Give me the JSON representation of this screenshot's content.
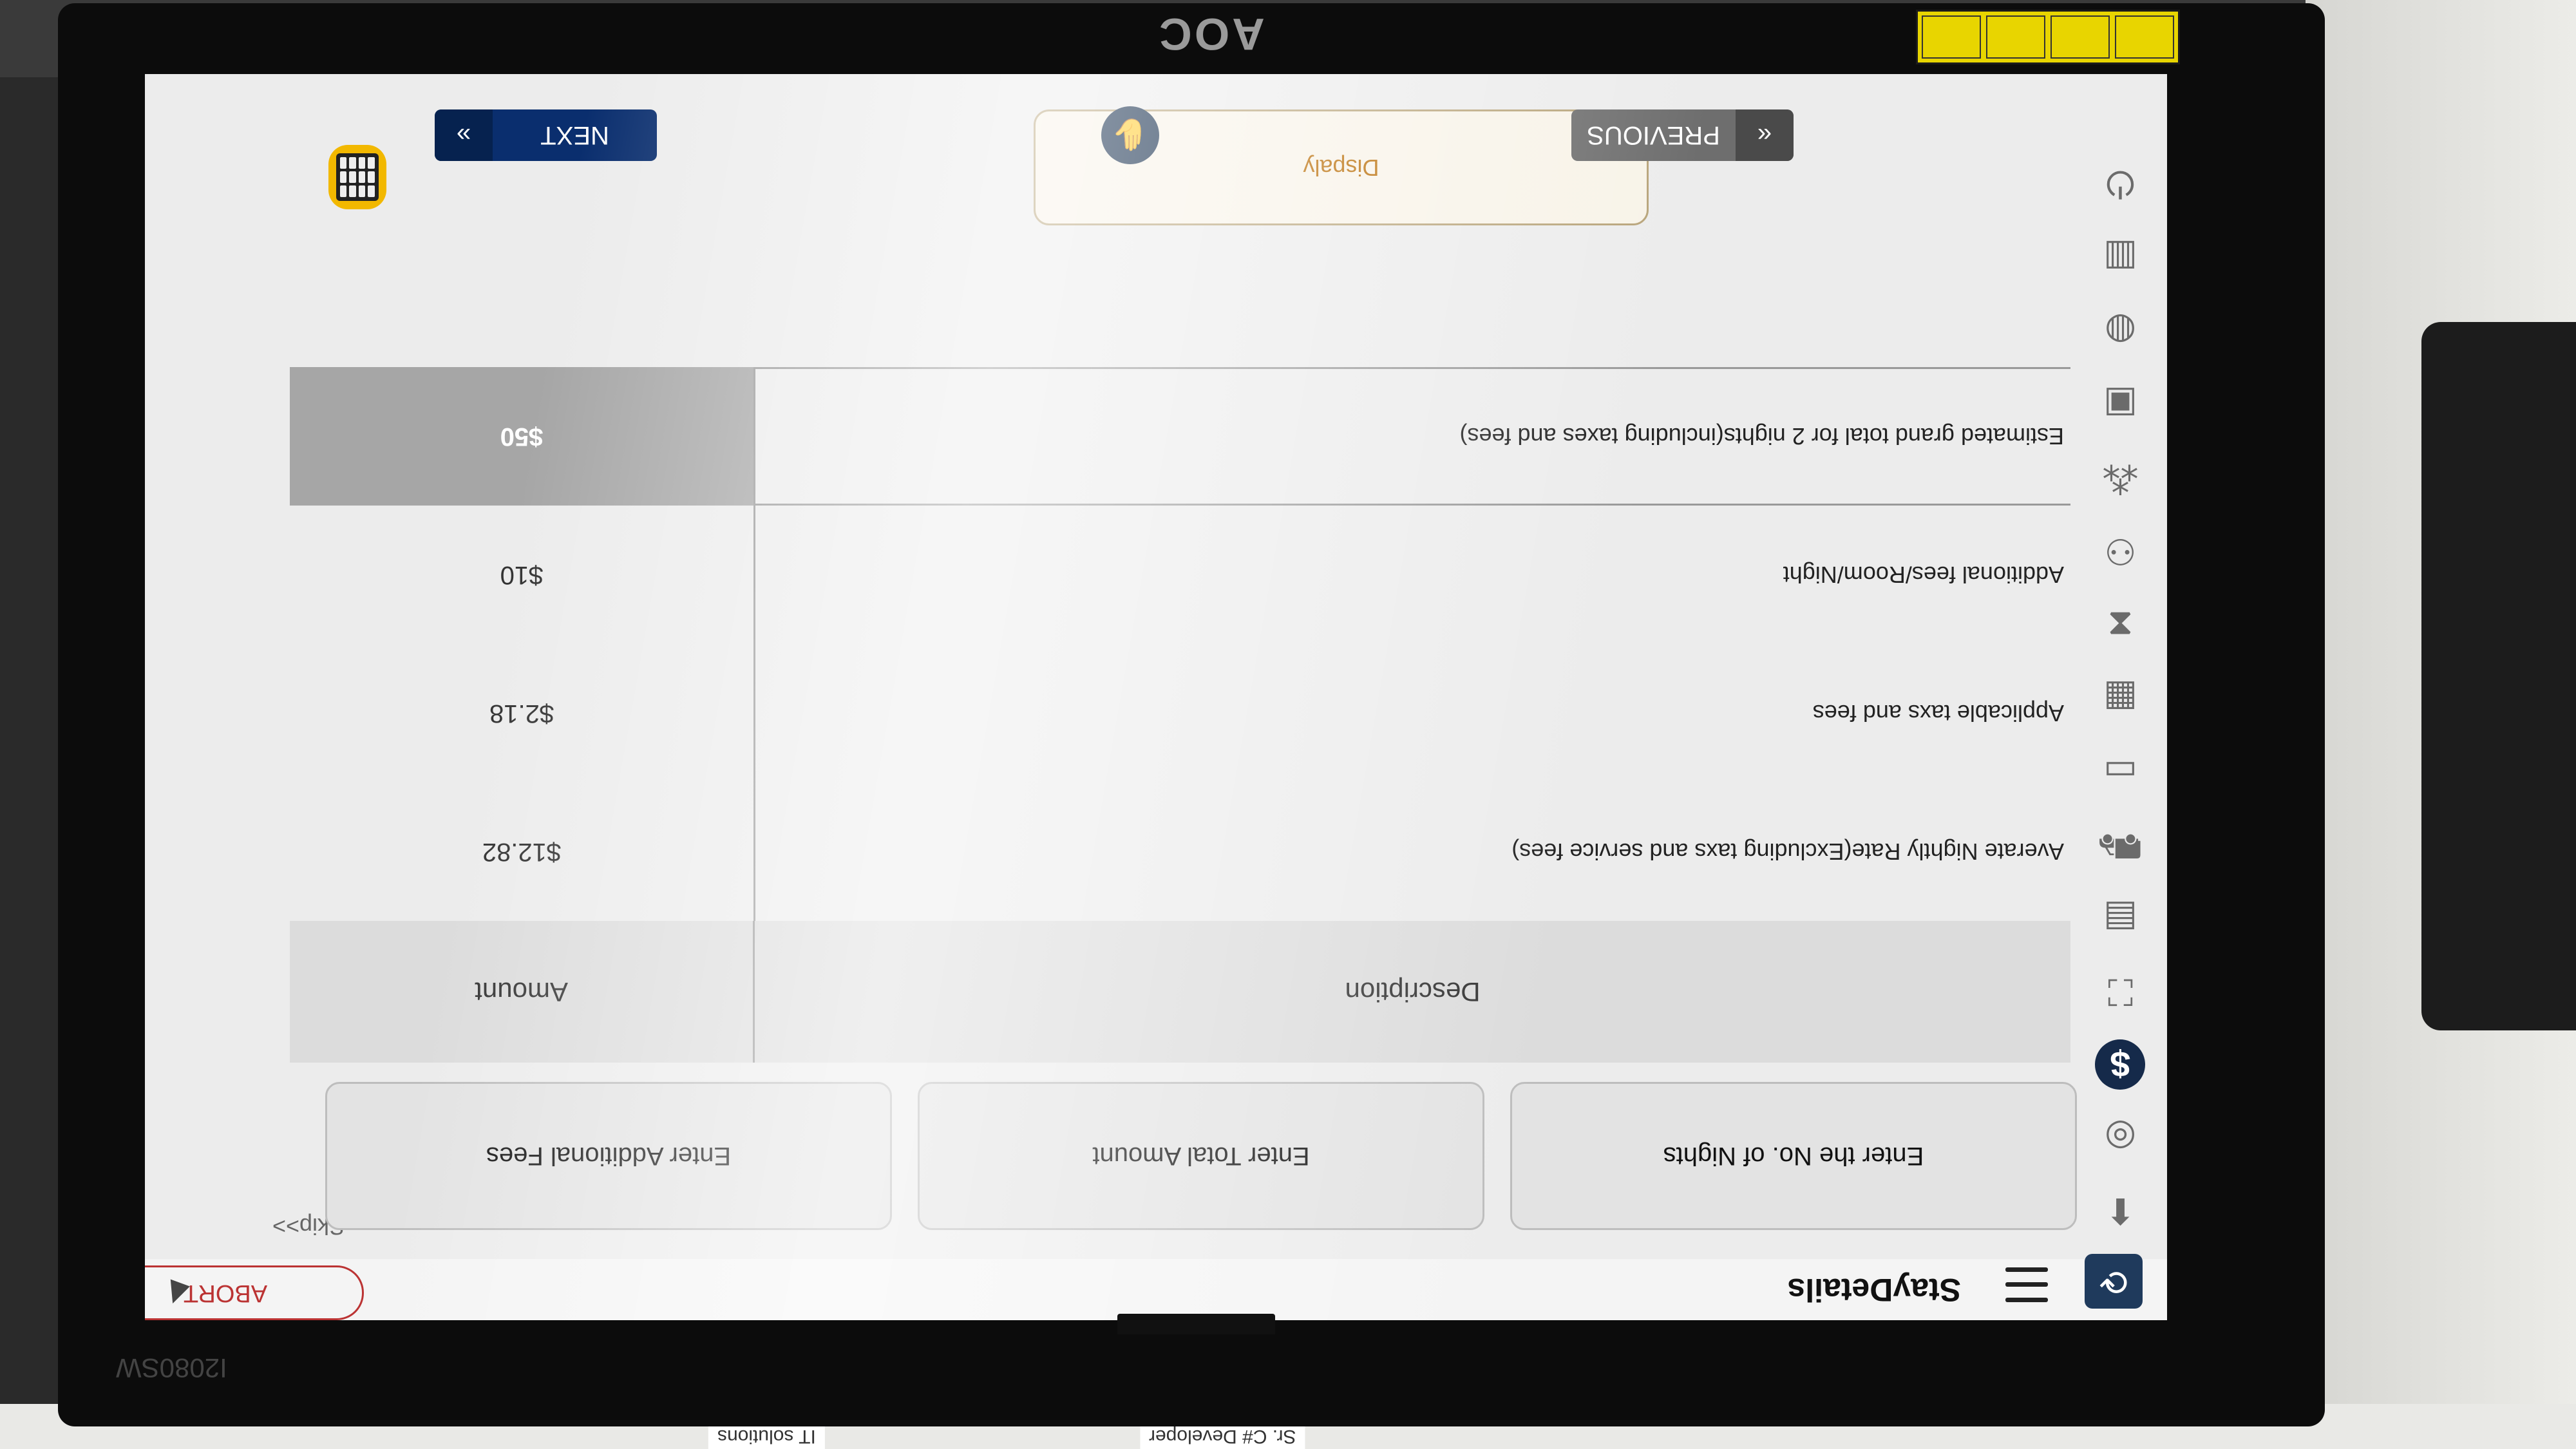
{
  "monitor": {
    "brand": "AOC",
    "model": "I2080SW"
  },
  "background": {
    "tag_left": "Sr. C# Developer",
    "tag_right": "IT solutions"
  },
  "header": {
    "title": "StayDetails",
    "abort_label": "ABORT",
    "skip_label": "Skip>>"
  },
  "sidebar": {
    "items": [
      {
        "icon": "arrow-icon"
      },
      {
        "icon": "globe-icon"
      },
      {
        "icon": "dollar-icon",
        "glyph": "$",
        "active": true
      },
      {
        "icon": "scan-icon"
      },
      {
        "icon": "id-card-icon"
      },
      {
        "icon": "car-icon"
      },
      {
        "icon": "key-card-icon"
      },
      {
        "icon": "receipt-icon"
      },
      {
        "icon": "hourglass-icon",
        "glyph": "⧗"
      },
      {
        "icon": "users-icon"
      },
      {
        "icon": "group-icon"
      },
      {
        "icon": "passport-icon"
      },
      {
        "icon": "world-icon"
      },
      {
        "icon": "document-icon"
      },
      {
        "icon": "power-icon",
        "glyph": "⏻"
      }
    ]
  },
  "options": [
    {
      "label": "Enter the No. of  Nights"
    },
    {
      "label": "Enter Total Amount"
    },
    {
      "label": "Enter Additional Fees"
    }
  ],
  "table": {
    "headers": {
      "description": "Description",
      "amount": "Amount"
    },
    "rows": [
      {
        "description": "Averate Nightly Rate(Excluding taxs and service fees)",
        "amount": "$12.82"
      },
      {
        "description": "Applicable taxs and fees",
        "amount": "$2.18"
      },
      {
        "description": "Additional fees/Room/Night",
        "amount": "$10"
      },
      {
        "description": "Estimated grand total for 2 nights(including taxes and fees)",
        "amount": "$50"
      }
    ]
  },
  "actions": {
    "display_label": "Dispaly",
    "previous_label": "PREVIOUS",
    "next_label": "NEXT"
  },
  "colors": {
    "primary_navy": "#0a2e6e",
    "abort_red": "#b33333",
    "display_orange": "#b86a00",
    "total_gray": "#a6a6a6",
    "calc_yellow": "#f2b800"
  }
}
